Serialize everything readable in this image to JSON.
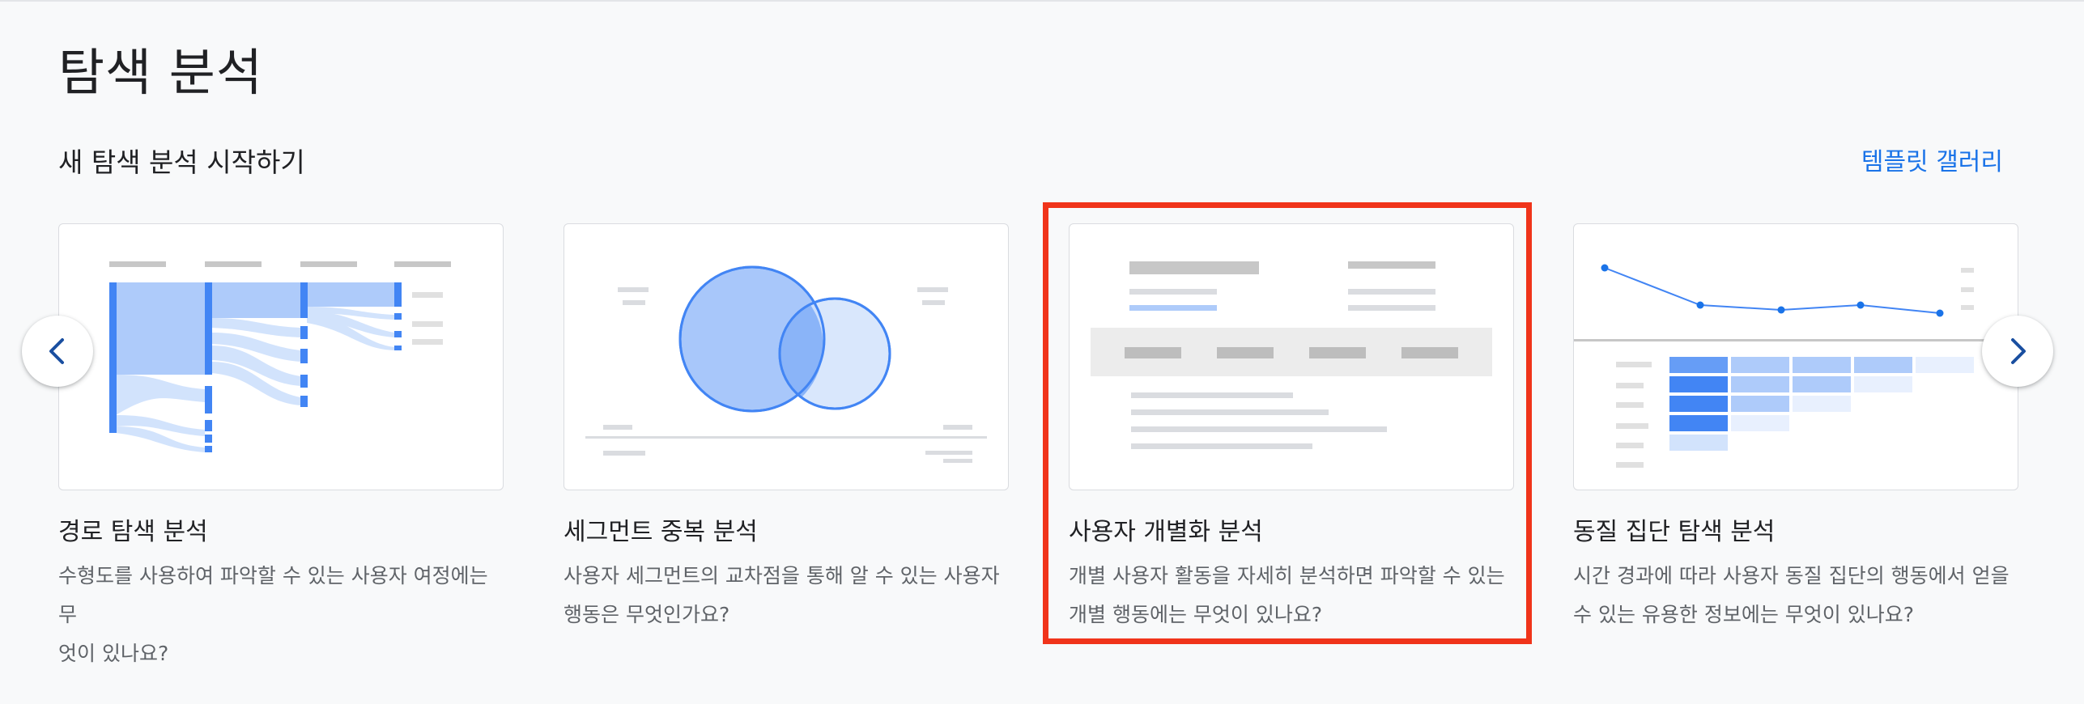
{
  "page": {
    "title": "탐색 분석",
    "section_title": "새 탐색 분석 시작하기",
    "gallery_link": "템플릿 갤러리"
  },
  "cards": [
    {
      "title": "경로 탐색 분석",
      "desc_line1": "수형도를 사용하여 파악할 수 있는 사용자 여정에는 무",
      "desc_line2": "엇이 있나요?",
      "thumbnail": "path-exploration-tree-diagram"
    },
    {
      "title": "세그먼트 중복 분석",
      "desc_line1": "사용자 세그먼트의 교차점을 통해 알 수 있는 사용자",
      "desc_line2": "행동은 무엇인가요?",
      "thumbnail": "segment-overlap-venn-diagram"
    },
    {
      "title": "사용자 개별화 분석",
      "desc_line1": "개별 사용자 활동을 자세히 분석하면 파악할 수 있는",
      "desc_line2": "개별 행동에는 무엇이 있나요?",
      "thumbnail": "user-explorer-table",
      "highlighted": true
    },
    {
      "title": "동질 집단 탐색 분석",
      "desc_line1": "시간 경과에 따라 사용자 동질 집단의 행동에서 얻을",
      "desc_line2": "수 있는 유용한 정보에는 무엇이 있나요?",
      "thumbnail": "cohort-exploration-heatmap"
    }
  ],
  "nav": {
    "prev_icon": "chevron-left-icon",
    "next_icon": "chevron-right-icon"
  },
  "colors": {
    "accent": "#1a73e8",
    "highlight_border": "#f0341a",
    "viz_blue": "#4285f4",
    "viz_light_blue": "#aecbfa",
    "placeholder_gray": "#c7c7c7"
  }
}
